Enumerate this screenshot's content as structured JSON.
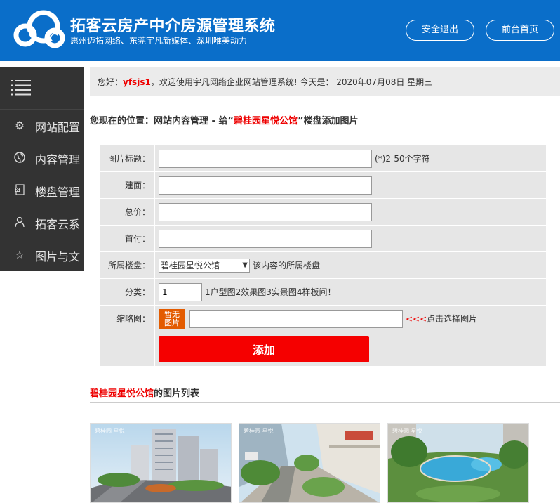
{
  "header": {
    "title": "拓客云房产中介房源管理系统",
    "subtitle": "惠州迈拓网络、东莞宇凡新媒体、深圳唯美动力",
    "logout_label": "安全退出",
    "home_label": "前台首页",
    "bg_color": "#0a6ec9"
  },
  "sidebar": {
    "items": [
      {
        "icon": "gear-icon",
        "label": "网站配置"
      },
      {
        "icon": "globe-icon",
        "label": "内容管理"
      },
      {
        "icon": "document-icon",
        "label": "楼盘管理"
      },
      {
        "icon": "user-icon",
        "label": "拓客云系"
      },
      {
        "icon": "star-icon",
        "label": "图片与文"
      }
    ]
  },
  "welcome": {
    "prefix": "您好：",
    "username": "yfsjs1",
    "message": "，欢迎使用宇凡网络企业网站管理系统! 今天是： 2020年07月08日 星期三"
  },
  "location": {
    "prefix": "您现在的位置：网站内容管理 - 给“",
    "property": "碧桂园星悦公馆",
    "suffix": "”楼盘添加图片"
  },
  "form": {
    "title_label": "图片标题：",
    "title_value": "",
    "title_hint": "(*)2-50个字符",
    "area_label": "建面：",
    "area_value": "",
    "price_label": "总价：",
    "price_value": "",
    "down_label": "首付：",
    "down_value": "",
    "property_label": "所属楼盘：",
    "property_selected": "碧桂园星悦公馆",
    "property_hint": "该内容的所属楼盘",
    "category_label": "分类：",
    "category_value": "1",
    "category_hint": "1户型图2效果图3实景图4样板间！",
    "thumb_label": "缩略图：",
    "thumb_button": "暂无图片",
    "thumb_value": "",
    "thumb_hint_arrows": "<<<",
    "thumb_hint": "点击选择图片",
    "submit_label": "添加",
    "submit_color": "#f50000"
  },
  "list": {
    "property": "碧桂园星悦公馆",
    "suffix": "的图片列表",
    "images": [
      {
        "caption": "碧桂园 星悦"
      },
      {
        "caption": "碧桂园 星悦"
      },
      {
        "caption": "碧桂园 星悦"
      }
    ]
  }
}
